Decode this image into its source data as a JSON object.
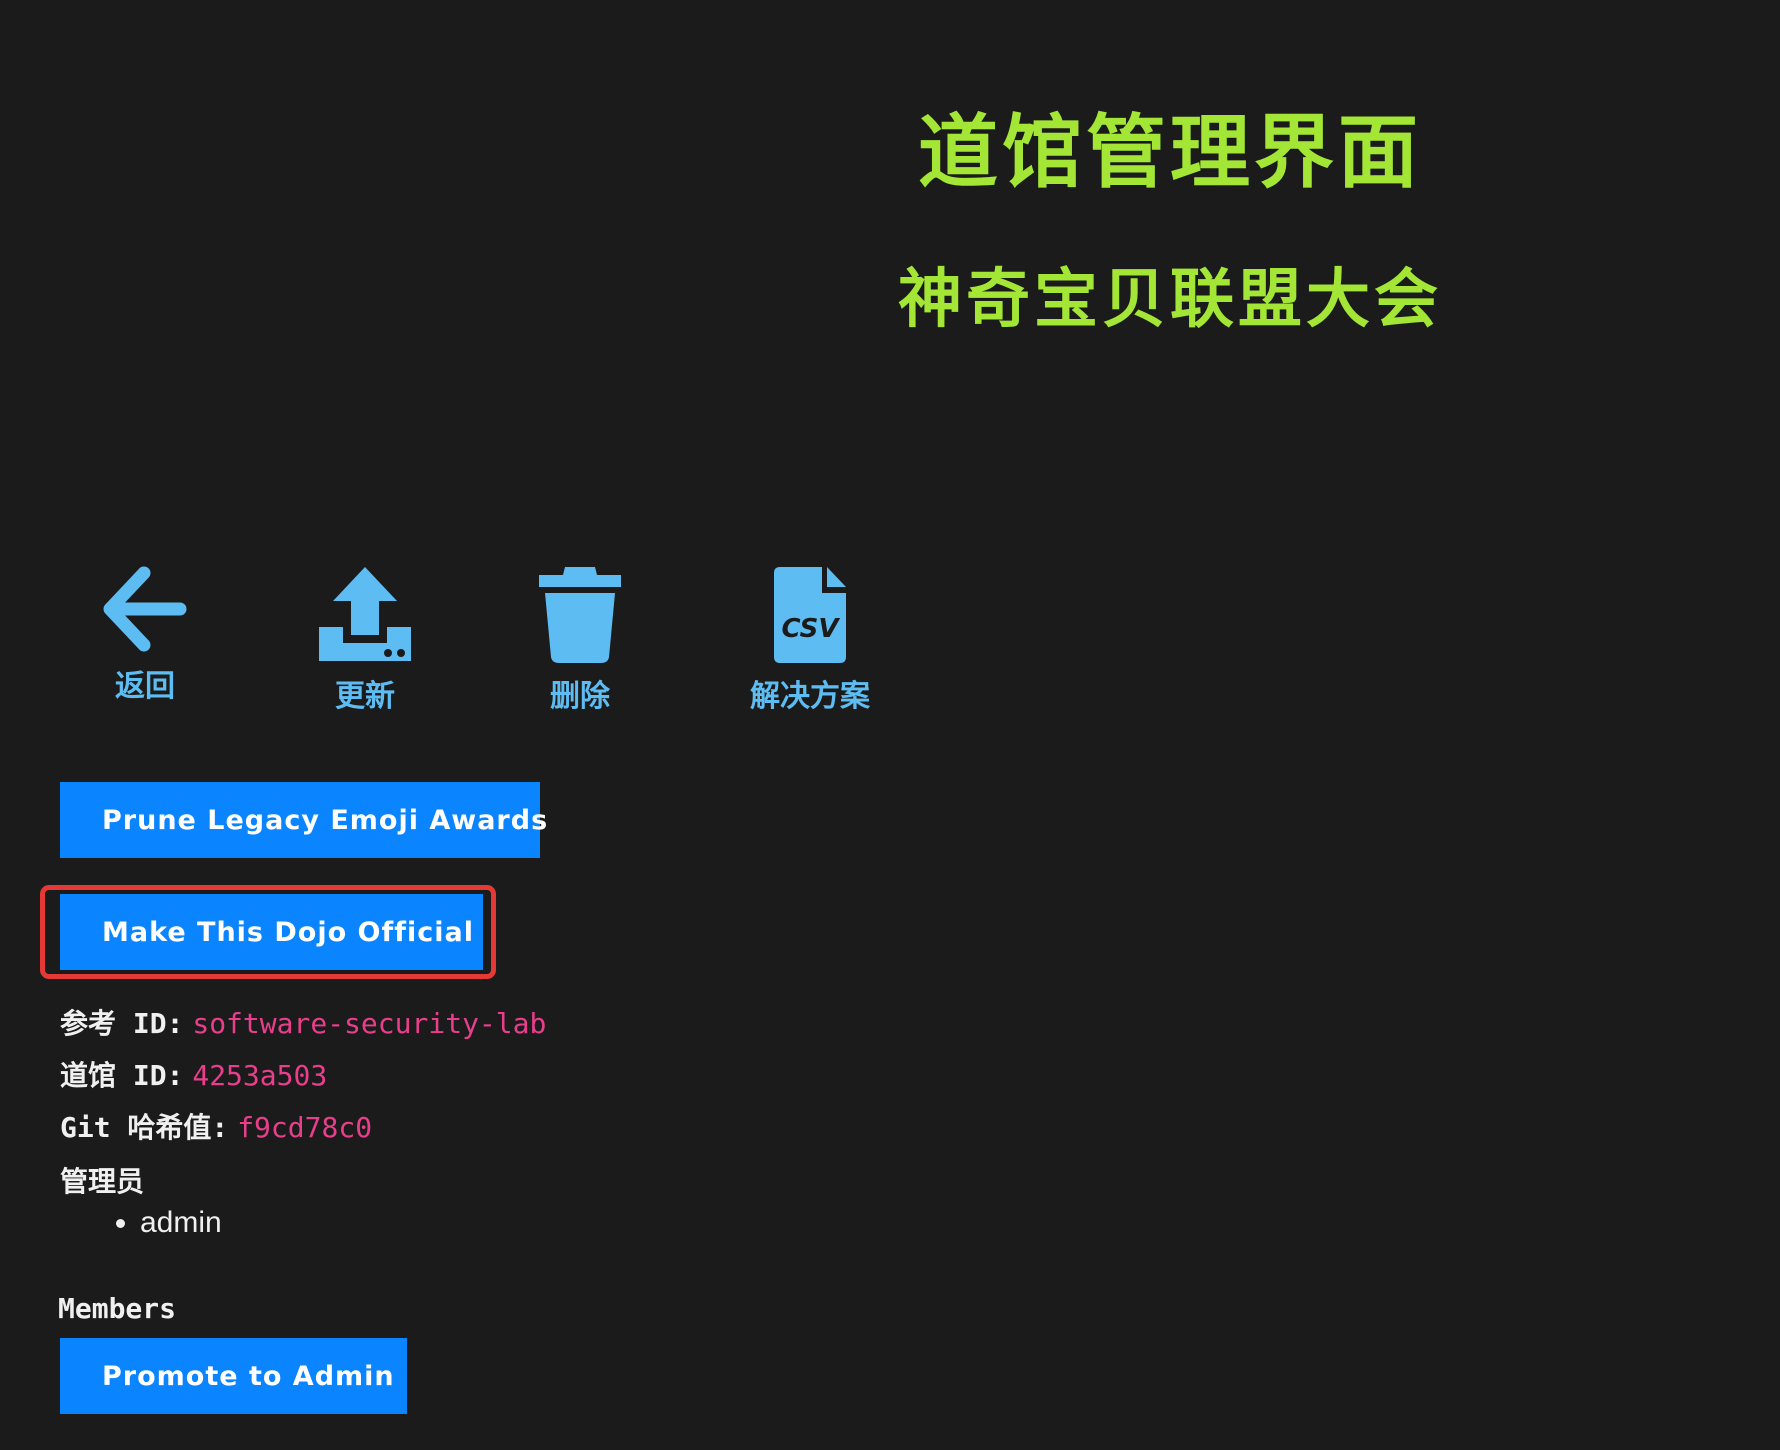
{
  "header": {
    "title": "道馆管理界面",
    "subtitle": "神奇宝贝联盟大会"
  },
  "toolbar": {
    "items": [
      {
        "label": "返回",
        "icon": "arrow-left-icon"
      },
      {
        "label": "更新",
        "icon": "upload-icon"
      },
      {
        "label": "删除",
        "icon": "trash-icon"
      },
      {
        "label": "解决方案",
        "icon": "csv-file-icon"
      }
    ],
    "icon_color": "#5dbcf2"
  },
  "actions": {
    "prune_label": "Prune Legacy Emoji Awards",
    "official_label": "Make This Dojo Official",
    "promote_label": "Promote to Admin",
    "button_color": "#0a84ff",
    "highlight_color": "#e53935"
  },
  "info": {
    "reference_id_key": "参考 ID:",
    "reference_id_value": "software-security-lab",
    "dojo_id_key": "道馆 ID:",
    "dojo_id_value": "4253a503",
    "git_hash_key": "Git 哈希值:",
    "git_hash_value": "f9cd78c0",
    "value_color": "#e83e8c"
  },
  "admins": {
    "label": "管理员",
    "list": [
      "admin"
    ]
  },
  "members": {
    "label": "Members"
  }
}
